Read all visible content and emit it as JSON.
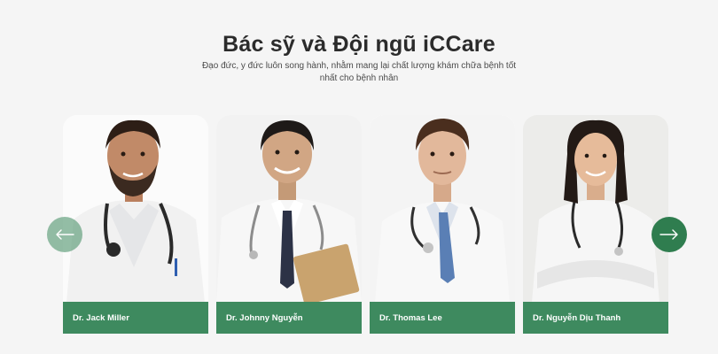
{
  "section": {
    "title": "Bác sỹ và Đội ngũ iCCare",
    "subtitle": "Đạo đức, y đức luôn song hành, nhằm mang lại chất lượng khám chữa bệnh tốt nhất cho bệnh nhân"
  },
  "doctors": [
    {
      "name": "Dr. Jack Miller"
    },
    {
      "name": "Dr. Johnny Nguyễn"
    },
    {
      "name": "Dr. Thomas Lee"
    },
    {
      "name": "Dr. Nguyễn Dịu Thanh"
    }
  ],
  "carousel": {
    "prev_icon": "arrow-left-icon",
    "next_icon": "arrow-right-icon"
  },
  "colors": {
    "accent": "#3e8a5f",
    "accent_dark": "#2f7d4f",
    "background": "#f5f5f5",
    "title": "#2b2b2b"
  }
}
